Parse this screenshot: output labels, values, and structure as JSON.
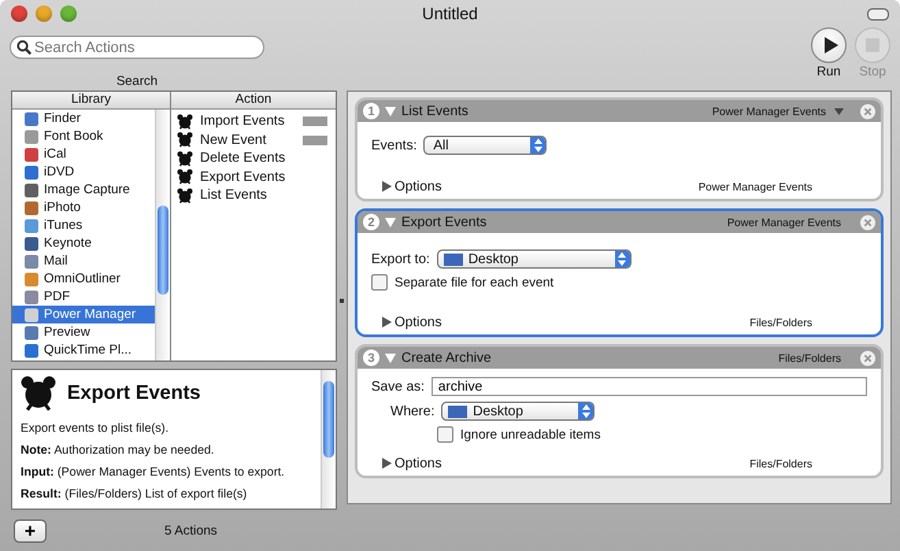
{
  "window": {
    "title": "Untitled"
  },
  "toolbar": {
    "search": {
      "placeholder": "Search Actions"
    },
    "search_label": "Search",
    "buttons": [
      {
        "label": "Run",
        "kind": "run",
        "disabled": false
      },
      {
        "label": "Stop",
        "kind": "stop",
        "disabled": true
      }
    ]
  },
  "library": {
    "header": "Library",
    "items": [
      {
        "label": "Finder",
        "selected": false,
        "color": "#4a78c8"
      },
      {
        "label": "Font Book",
        "selected": false,
        "color": "#9a9a9a"
      },
      {
        "label": "iCal",
        "selected": false,
        "color": "#d04040"
      },
      {
        "label": "iDVD",
        "selected": false,
        "color": "#2f6fd0"
      },
      {
        "label": "Image Capture",
        "selected": false,
        "color": "#606060"
      },
      {
        "label": "iPhoto",
        "selected": false,
        "color": "#b06a30"
      },
      {
        "label": "iTunes",
        "selected": false,
        "color": "#5a9ad8"
      },
      {
        "label": "Keynote",
        "selected": false,
        "color": "#3a5a90"
      },
      {
        "label": "Mail",
        "selected": false,
        "color": "#7a8aa8"
      },
      {
        "label": "OmniOutliner",
        "selected": false,
        "color": "#d88a30"
      },
      {
        "label": "PDF",
        "selected": false,
        "color": "#8a8aa0"
      },
      {
        "label": "Power Manager",
        "selected": true,
        "color": "#d0d0d0"
      },
      {
        "label": "Preview",
        "selected": false,
        "color": "#5a7ab0"
      },
      {
        "label": "QuickTime Pl...",
        "selected": false,
        "color": "#2a70d0"
      }
    ]
  },
  "actions": {
    "header": "Action",
    "items": [
      {
        "label": "Import Events",
        "marked": true
      },
      {
        "label": "New Event",
        "marked": true
      },
      {
        "label": "Delete Events",
        "marked": false
      },
      {
        "label": "Export Events",
        "marked": false
      },
      {
        "label": "List Events",
        "marked": false
      }
    ]
  },
  "description": {
    "title": "Export Events",
    "paragraphs": [
      "Export events to plist file(s).",
      "**Note:** Authorization may be needed.",
      "**Input:** (Power Manager Events) Events to export.",
      "**Result:** (Files/Folders) List of export file(s)"
    ]
  },
  "status_bar": {
    "add_button": "+",
    "count": "5 Actions"
  },
  "workflow": [
    {
      "number": "1",
      "title": "List Events",
      "input": "Power Manager Events",
      "input_menu": true,
      "selected": false,
      "options": "Options",
      "output": "Power Manager Events",
      "fields": [
        {
          "kind": "popup",
          "label": "Events:",
          "value": "All",
          "folder": false
        }
      ]
    },
    {
      "number": "2",
      "title": "Export Events",
      "input": "Power Manager Events",
      "input_menu": false,
      "selected": true,
      "options": "Options",
      "output": "Files/Folders",
      "fields": [
        {
          "kind": "popup",
          "label": "Export to:",
          "value": "Desktop",
          "folder": true
        },
        {
          "kind": "checkbox",
          "label": "Separate file for each event",
          "checked": false
        }
      ]
    },
    {
      "number": "3",
      "title": "Create Archive",
      "input": "Files/Folders",
      "input_menu": false,
      "selected": false,
      "options": "Options",
      "output": "Files/Folders",
      "fields": [
        {
          "kind": "text",
          "label": "Save as:",
          "value": "archive"
        },
        {
          "kind": "popup",
          "label": "Where:",
          "value": "Desktop",
          "folder": true
        },
        {
          "kind": "checkbox",
          "label": "Ignore unreadable items",
          "checked": false
        }
      ]
    }
  ]
}
